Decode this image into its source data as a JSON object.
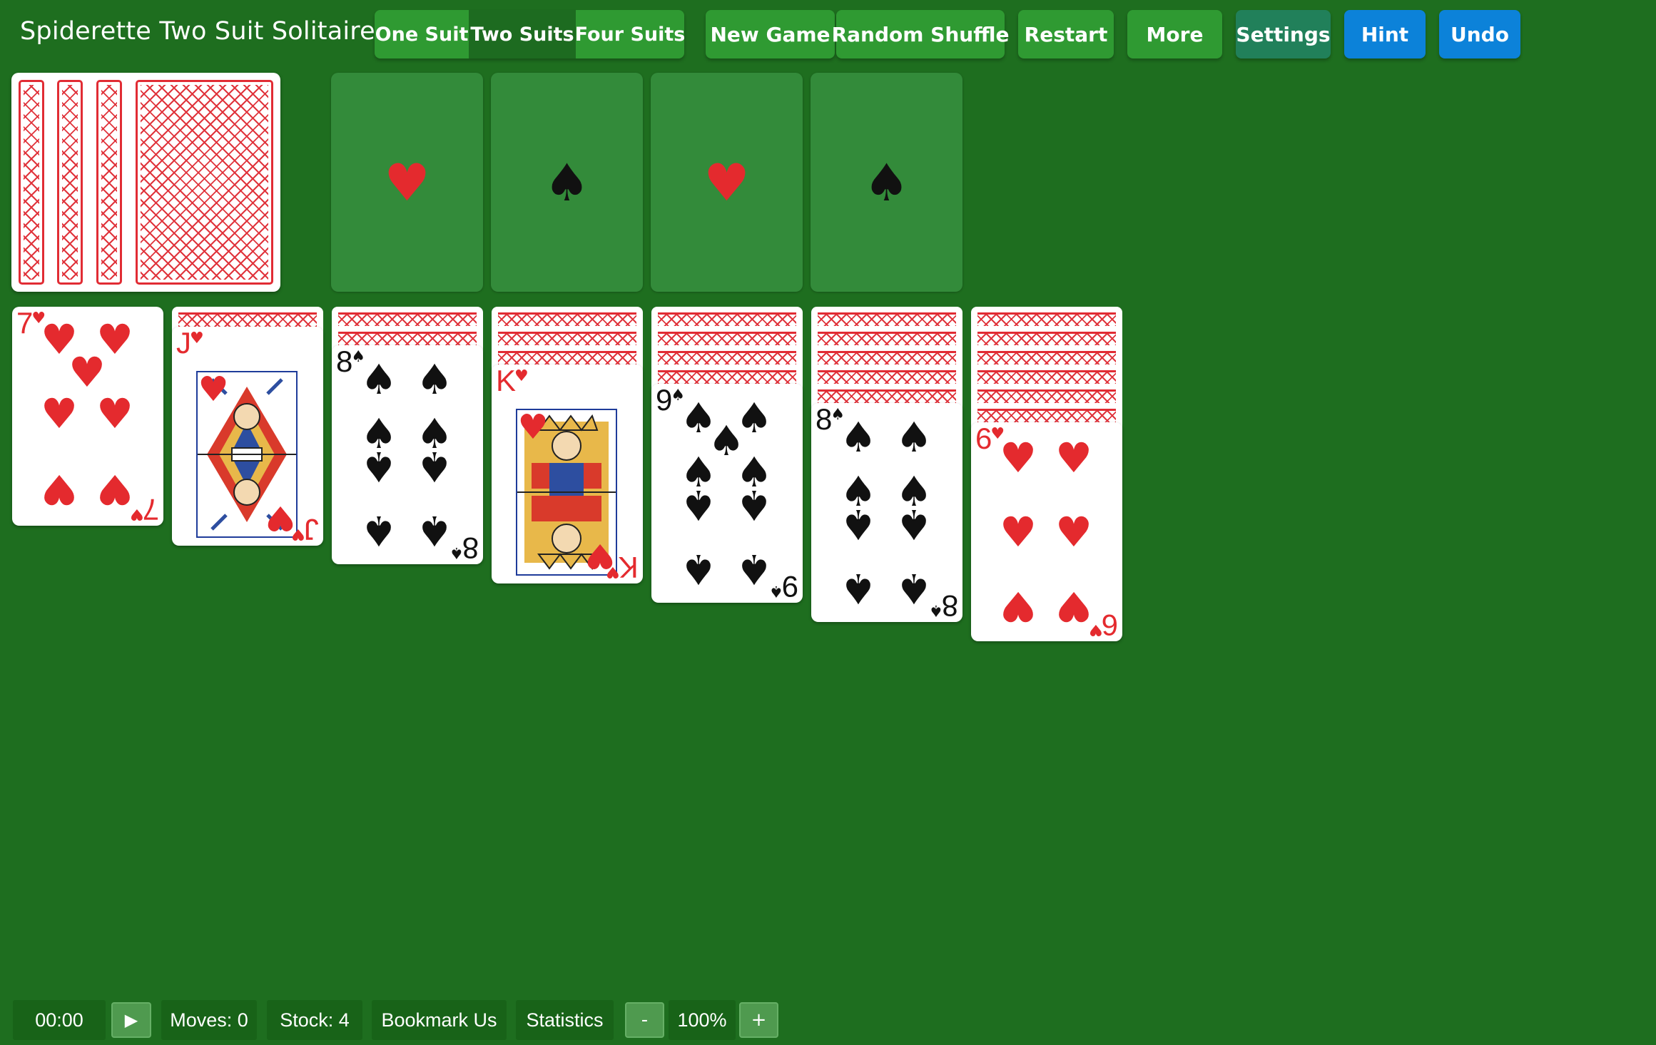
{
  "header": {
    "title": "Spiderette Two Suit Solitaire",
    "suit_options": [
      "One Suit",
      "Two Suits",
      "Four Suits"
    ],
    "selected_suit_option": "Two Suits",
    "buttons": {
      "new_game": "New Game",
      "random_shuffle": "Random Shuffle",
      "restart": "Restart",
      "more": "More",
      "settings": "Settings",
      "hint": "Hint",
      "undo": "Undo"
    }
  },
  "stock_pile": {
    "visible_backs": 4
  },
  "foundations": [
    {
      "suit": "♥",
      "color": "#e42a2e"
    },
    {
      "suit": "♠",
      "color": "#111111"
    },
    {
      "suit": "♥",
      "color": "#e42a2e"
    },
    {
      "suit": "♠",
      "color": "#111111"
    }
  ],
  "tableau": [
    {
      "face_down": 0,
      "card": {
        "rank": "7",
        "suit": "♥"
      }
    },
    {
      "face_down": 1,
      "card": {
        "rank": "J",
        "suit": "♥"
      }
    },
    {
      "face_down": 2,
      "card": {
        "rank": "8",
        "suit": "♠"
      }
    },
    {
      "face_down": 3,
      "card": {
        "rank": "K",
        "suit": "♥"
      }
    },
    {
      "face_down": 4,
      "card": {
        "rank": "9",
        "suit": "♠"
      }
    },
    {
      "face_down": 5,
      "card": {
        "rank": "8",
        "suit": "♠"
      }
    },
    {
      "face_down": 6,
      "card": {
        "rank": "6",
        "suit": "♥"
      }
    }
  ],
  "footer": {
    "timer": "00:00",
    "play_icon": "▶",
    "moves": "Moves: 0",
    "stock": "Stock: 4",
    "bookmark": "Bookmark Us",
    "statistics": "Statistics",
    "zoom_out": "-",
    "zoom": "100%",
    "zoom_in": "+"
  },
  "colors": {
    "table_green": "#1e6e1f",
    "button_green": "#2f9a32",
    "button_blue": "#0c82d9",
    "card_red": "#e42a2e",
    "card_black": "#111111"
  }
}
